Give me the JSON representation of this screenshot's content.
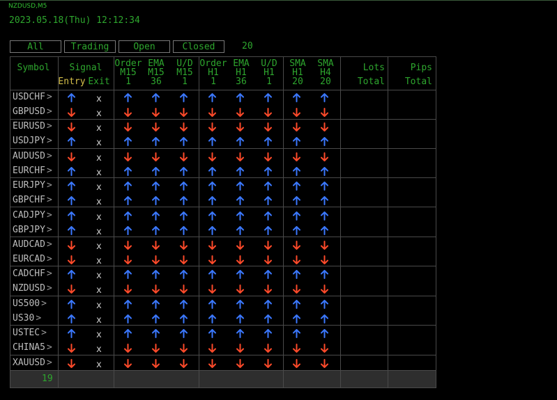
{
  "chart_title": "NZDUSD,M5",
  "datetime": "2023.05.18(Thu) 12:12:34",
  "filters": [
    {
      "label": "All"
    },
    {
      "label": "Trading"
    },
    {
      "label": "Open"
    },
    {
      "label": "Closed"
    }
  ],
  "filter_count": "20",
  "headers": {
    "symbol": "Symbol",
    "signal": "Signal",
    "entry": "Entry",
    "exit": "Exit",
    "order_m15": [
      "Order",
      "M15",
      "1"
    ],
    "ema_m15": [
      "EMA",
      "M15",
      "36"
    ],
    "ud_m15": [
      "U/D",
      "M15",
      "1"
    ],
    "order_h1": [
      "Order",
      "H1",
      "1"
    ],
    "ema_h1": [
      "EMA",
      "H1",
      "36"
    ],
    "ud_h1": [
      "U/D",
      "H1",
      "1"
    ],
    "sma_h1": [
      "SMA",
      "H1",
      "20"
    ],
    "sma_h4": [
      "SMA",
      "H4",
      "20"
    ],
    "lots": [
      "Lots",
      "Total"
    ],
    "pips": [
      "Pips",
      "Total"
    ]
  },
  "rows": [
    {
      "symbol": "USDCHF",
      "entry": "up",
      "signals": [
        "up",
        "up",
        "up",
        "up",
        "up",
        "up",
        "up",
        "up"
      ]
    },
    {
      "symbol": "GBPUSD",
      "entry": "down",
      "signals": [
        "down",
        "down",
        "down",
        "down",
        "down",
        "down",
        "down",
        "down"
      ]
    },
    {
      "symbol": "EURUSD",
      "entry": "down",
      "signals": [
        "down",
        "down",
        "down",
        "down",
        "down",
        "down",
        "down",
        "down"
      ]
    },
    {
      "symbol": "USDJPY",
      "entry": "up",
      "signals": [
        "up",
        "up",
        "up",
        "up",
        "up",
        "up",
        "up",
        "up"
      ]
    },
    {
      "symbol": "AUDUSD",
      "entry": "down",
      "signals": [
        "down",
        "down",
        "down",
        "down",
        "down",
        "down",
        "down",
        "down"
      ]
    },
    {
      "symbol": "EURCHF",
      "entry": "up",
      "signals": [
        "up",
        "up",
        "up",
        "up",
        "up",
        "up",
        "up",
        "up"
      ]
    },
    {
      "symbol": "EURJPY",
      "entry": "up",
      "signals": [
        "up",
        "up",
        "up",
        "up",
        "up",
        "up",
        "up",
        "up"
      ]
    },
    {
      "symbol": "GBPCHF",
      "entry": "up",
      "signals": [
        "up",
        "up",
        "up",
        "up",
        "up",
        "up",
        "up",
        "up"
      ]
    },
    {
      "symbol": "CADJPY",
      "entry": "up",
      "signals": [
        "up",
        "up",
        "up",
        "up",
        "up",
        "up",
        "up",
        "up"
      ]
    },
    {
      "symbol": "GBPJPY",
      "entry": "up",
      "signals": [
        "up",
        "up",
        "up",
        "up",
        "up",
        "up",
        "up",
        "up"
      ]
    },
    {
      "symbol": "AUDCAD",
      "entry": "down",
      "signals": [
        "down",
        "down",
        "down",
        "down",
        "down",
        "down",
        "down",
        "down"
      ]
    },
    {
      "symbol": "EURCAD",
      "entry": "down",
      "signals": [
        "down",
        "down",
        "down",
        "down",
        "down",
        "down",
        "down",
        "down"
      ]
    },
    {
      "symbol": "CADCHF",
      "entry": "up",
      "signals": [
        "up",
        "up",
        "up",
        "up",
        "up",
        "up",
        "up",
        "up"
      ]
    },
    {
      "symbol": "NZDUSD",
      "entry": "down",
      "signals": [
        "down",
        "down",
        "down",
        "down",
        "down",
        "down",
        "down",
        "down"
      ]
    },
    {
      "symbol": "US500",
      "entry": "up",
      "signals": [
        "up",
        "up",
        "up",
        "up",
        "up",
        "up",
        "up",
        "up"
      ]
    },
    {
      "symbol": "US30",
      "entry": "up",
      "signals": [
        "up",
        "up",
        "up",
        "up",
        "up",
        "up",
        "up",
        "up"
      ]
    },
    {
      "symbol": "USTEC",
      "entry": "up",
      "signals": [
        "up",
        "up",
        "up",
        "up",
        "up",
        "up",
        "up",
        "up"
      ]
    },
    {
      "symbol": "CHINA5",
      "entry": "down",
      "signals": [
        "down",
        "down",
        "down",
        "down",
        "down",
        "down",
        "down",
        "down"
      ]
    },
    {
      "symbol": "XAUUSD",
      "entry": "down",
      "signals": [
        "down",
        "down",
        "down",
        "down",
        "down",
        "down",
        "down",
        "down"
      ]
    }
  ],
  "exit_mark": "x",
  "chevron": ">",
  "footer_count": "19",
  "colors": {
    "up": "#3b78ff",
    "down": "#ff4a2a",
    "header_text": "#2ea62e",
    "entry_text": "#d6c04a",
    "symbol_text": "#bdbdbd"
  }
}
